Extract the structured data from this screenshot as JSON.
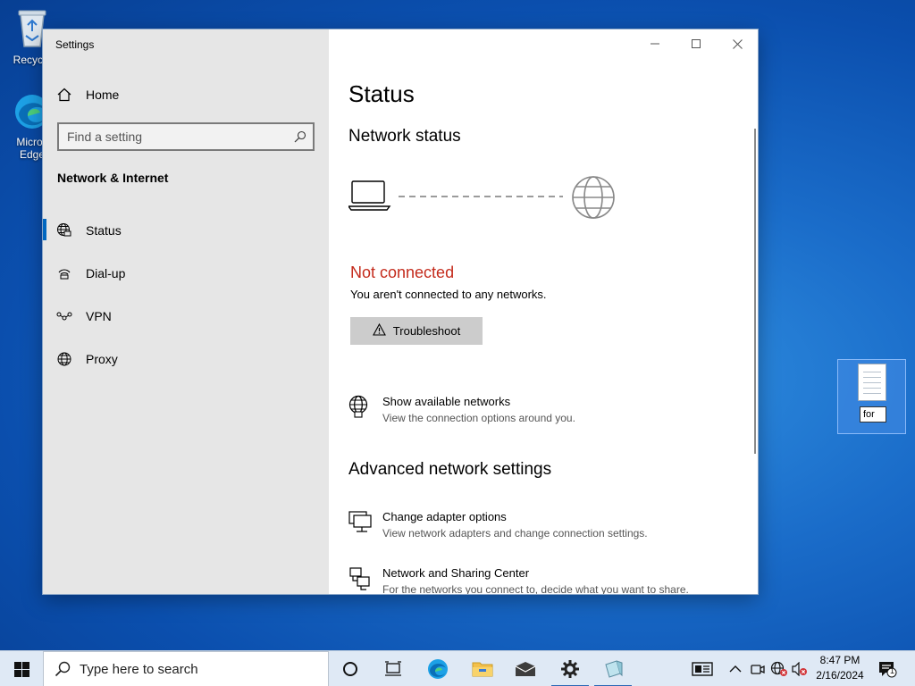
{
  "desktop": {
    "recycle_bin_label": "Recycle",
    "edge_label_1": "Micros",
    "edge_label_2": "Edge",
    "file_rename_value": "for"
  },
  "window": {
    "title": "Settings",
    "minimize": "—",
    "maximize": "☐",
    "close": "✕"
  },
  "sidebar": {
    "home_label": "Home",
    "search_placeholder": "Find a setting",
    "section_title": "Network & Internet",
    "items": [
      {
        "label": "Status",
        "icon": "globe-status-icon",
        "selected": true
      },
      {
        "label": "Dial-up",
        "icon": "dialup-icon",
        "selected": false
      },
      {
        "label": "VPN",
        "icon": "vpn-icon",
        "selected": false
      },
      {
        "label": "Proxy",
        "icon": "globe-icon",
        "selected": false
      }
    ]
  },
  "main": {
    "page_title": "Status",
    "network_status_heading": "Network status",
    "connection_state": "Not connected",
    "connection_detail": "You aren't connected to any networks.",
    "troubleshoot_label": "Troubleshoot",
    "show_networks": {
      "title": "Show available networks",
      "subtitle": "View the connection options around you."
    },
    "advanced_heading": "Advanced network settings",
    "adapter_options": {
      "title": "Change adapter options",
      "subtitle": "View network adapters and change connection settings."
    },
    "sharing_center": {
      "title": "Network and Sharing Center",
      "subtitle": "For the networks you connect to, decide what you want to share."
    }
  },
  "taskbar": {
    "search_placeholder": "Type here to search",
    "time": "8:47 PM",
    "date": "2/16/2024",
    "notification_count": "1"
  },
  "colors": {
    "error_red": "#c42b1c",
    "accent_blue": "#0067c0",
    "sidebar_bg": "#e6e6e6"
  }
}
